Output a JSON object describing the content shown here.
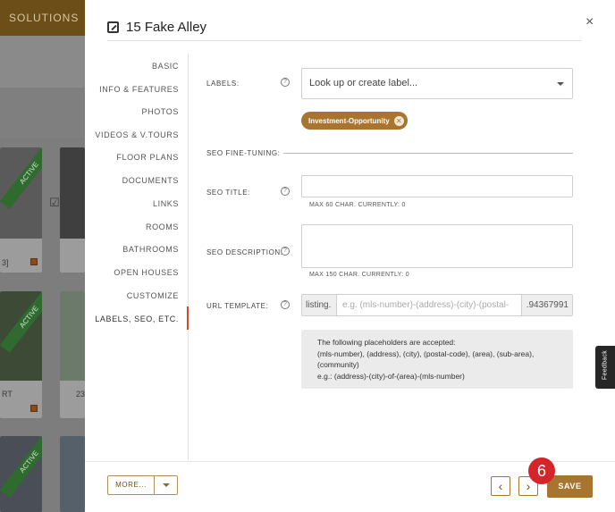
{
  "background": {
    "header_label": "SOLUTIONS",
    "card_ribbon": "ACTIVE",
    "card_texts": [
      "3]",
      "RT",
      "23"
    ]
  },
  "modal": {
    "title": "15 Fake Alley",
    "close_label": "×"
  },
  "nav": {
    "items": [
      {
        "label": "BASIC"
      },
      {
        "label": "INFO & FEATURES"
      },
      {
        "label": "PHOTOS"
      },
      {
        "label": "VIDEOS & V.TOURS"
      },
      {
        "label": "FLOOR PLANS"
      },
      {
        "label": "DOCUMENTS"
      },
      {
        "label": "LINKS"
      },
      {
        "label": "ROOMS"
      },
      {
        "label": "BATHROOMS"
      },
      {
        "label": "OPEN HOUSES"
      },
      {
        "label": "CUSTOMIZE"
      },
      {
        "label": "LABELS, SEO, ETC."
      }
    ],
    "active_index": 11
  },
  "form": {
    "labels_label": "LABELS:",
    "labels_placeholder": "Look up or create label...",
    "labels_chip": "Investment-Opportunity",
    "seo_section": "SEO FINE-TUNING:",
    "seo_title_label": "SEO TITLE:",
    "seo_title_value": "",
    "seo_title_hint": "MAX 60 CHAR. CURRENTLY: 0",
    "seo_description_label": "SEO DESCRIPTION:",
    "seo_description_value": "",
    "seo_description_hint": "MAX 150 CHAR. CURRENTLY: 0",
    "url_template_label": "URL TEMPLATE:",
    "url_prefix": "listing.",
    "url_placeholder": "e.g. (mls-number)-(address)-(city)-(postal-",
    "url_suffix": ".94367991",
    "info_lines": [
      "The following placeholders are accepted:",
      "(mls-number), (address), (city), (postal-code), (area), (sub-area),",
      "(community)",
      "e.g.: (address)-(city)-of-(area)-(mls-number)"
    ]
  },
  "footer": {
    "more_label": "MORE...",
    "prev_icon": "‹",
    "next_icon": "›",
    "save_label": "SAVE",
    "step_badge": "6"
  },
  "feedback_label": "Feedback",
  "colors": {
    "accent": "#a87530",
    "active_nav": "#d04a2e",
    "badge": "#d4262a",
    "ribbon": "#2f6a2f"
  }
}
